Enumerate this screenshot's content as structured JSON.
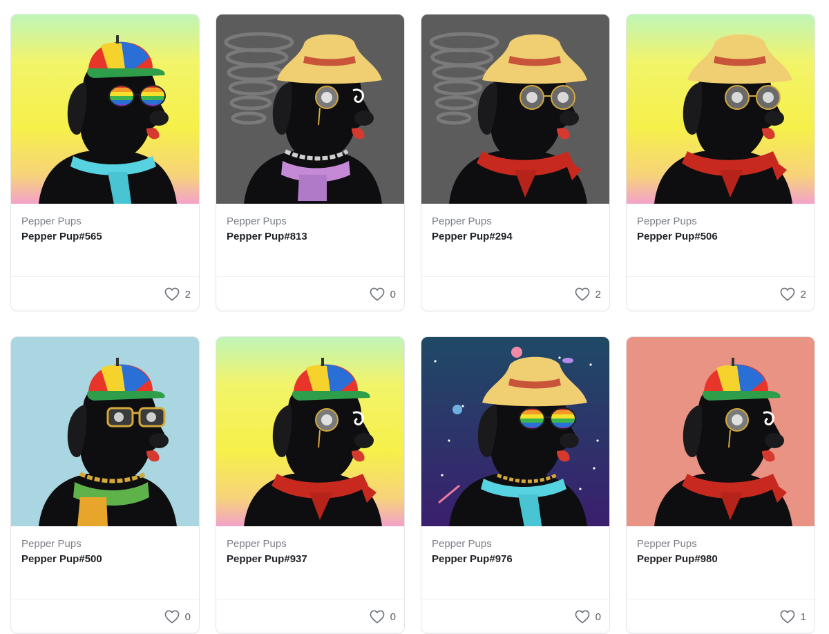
{
  "cards": [
    {
      "collection": "Pepper Pups",
      "name": "Pepper Pup#565",
      "likes": "2",
      "background": "gradient",
      "hat": "propeller-cap",
      "eyewear": "rainbow-sunglasses",
      "neck": "cyan-scarf"
    },
    {
      "collection": "Pepper Pups",
      "name": "Pepper Pup#813",
      "likes": "0",
      "background": "tornado",
      "hat": "straw-hat",
      "eyewear": "monocle",
      "neck": "pink-scarf-chain"
    },
    {
      "collection": "Pepper Pups",
      "name": "Pepper Pup#294",
      "likes": "2",
      "background": "tornado",
      "hat": "straw-hat",
      "eyewear": "round-glasses",
      "neck": "red-bandana"
    },
    {
      "collection": "Pepper Pups",
      "name": "Pepper Pup#506",
      "likes": "2",
      "background": "gradient",
      "hat": "straw-hat",
      "eyewear": "round-glasses",
      "neck": "red-bandana"
    },
    {
      "collection": "Pepper Pups",
      "name": "Pepper Pup#500",
      "likes": "0",
      "background": "light-blue",
      "hat": "propeller-cap",
      "eyewear": "gold-sunglasses",
      "neck": "green-scarf-chain"
    },
    {
      "collection": "Pepper Pups",
      "name": "Pepper Pup#937",
      "likes": "0",
      "background": "gradient",
      "hat": "propeller-cap",
      "eyewear": "monocle",
      "neck": "red-bandana"
    },
    {
      "collection": "Pepper Pups",
      "name": "Pepper Pup#976",
      "likes": "0",
      "background": "space",
      "hat": "straw-hat",
      "eyewear": "rainbow-sunglasses",
      "neck": "cyan-scarf-chain"
    },
    {
      "collection": "Pepper Pups",
      "name": "Pepper Pup#980",
      "likes": "1",
      "background": "salmon",
      "hat": "propeller-cap",
      "eyewear": "monocle",
      "neck": "red-bandana"
    }
  ],
  "icons": {
    "like": "heart-outline-icon"
  },
  "colors": {
    "dog": "#0e0e10",
    "gradient_top": "#bff5b8",
    "gradient_mid": "#f6f04a",
    "gradient_bottom": "#f3a2c9",
    "tornado_bg": "#5c5c5c",
    "light_blue": "#a9d6e0",
    "salmon": "#e99385",
    "space_top": "#1f4a66",
    "space_bottom": "#3a1f6e"
  }
}
